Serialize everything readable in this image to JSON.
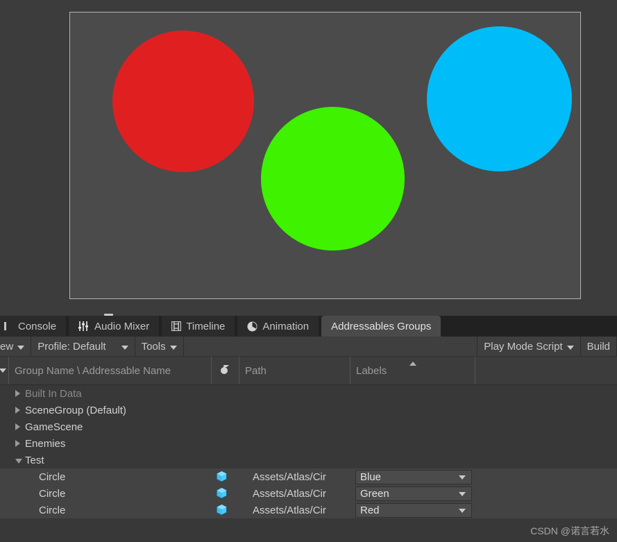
{
  "game_view": {
    "background": "#4b4b4b",
    "objects": [
      {
        "name": "circle-red",
        "color": "#e02020"
      },
      {
        "name": "circle-green",
        "color": "#3ef200"
      },
      {
        "name": "circle-blue",
        "color": "#00bdf9"
      }
    ]
  },
  "tabs": [
    {
      "id": "console",
      "label": "Console",
      "icon": "console-icon",
      "active": false
    },
    {
      "id": "audio-mixer",
      "label": "Audio Mixer",
      "icon": "sliders-icon",
      "active": false
    },
    {
      "id": "timeline",
      "label": "Timeline",
      "icon": "film-icon",
      "active": false
    },
    {
      "id": "animation",
      "label": "Animation",
      "icon": "clock-icon",
      "active": false
    },
    {
      "id": "addressables-groups",
      "label": "Addressables Groups",
      "icon": "",
      "active": true
    }
  ],
  "toolbar": {
    "new_label": "ew",
    "profile_label": "Profile: Default",
    "tools_label": "Tools",
    "play_mode_script_label": "Play Mode Script",
    "build_label": "Build"
  },
  "columns": [
    {
      "id": "name",
      "label": "Group Name \\ Addressable Name"
    },
    {
      "id": "icon",
      "label": ""
    },
    {
      "id": "path",
      "label": "Path"
    },
    {
      "id": "labels",
      "label": "Labels"
    },
    {
      "id": "extra",
      "label": ""
    }
  ],
  "sort": {
    "column": "labels",
    "direction": "ascending"
  },
  "tree": [
    {
      "type": "group",
      "label": "Built In Data",
      "expanded": false,
      "dim": true,
      "selected": false
    },
    {
      "type": "group",
      "label": "SceneGroup (Default)",
      "expanded": false,
      "dim": false,
      "selected": false
    },
    {
      "type": "group",
      "label": "GameScene",
      "expanded": false,
      "dim": false,
      "selected": false
    },
    {
      "type": "group",
      "label": "Enemies",
      "expanded": false,
      "dim": false,
      "selected": false
    },
    {
      "type": "group",
      "label": "Test",
      "expanded": true,
      "dim": false,
      "selected": false
    },
    {
      "type": "entry",
      "label": "Circle",
      "icon": "prefab-icon",
      "path": "Assets/Atlas/Cir",
      "label_value": "Blue",
      "selected": true
    },
    {
      "type": "entry",
      "label": "Circle",
      "icon": "prefab-icon",
      "path": "Assets/Atlas/Cir",
      "label_value": "Green",
      "selected": true
    },
    {
      "type": "entry",
      "label": "Circle",
      "icon": "prefab-icon",
      "path": "Assets/Atlas/Cir",
      "label_value": "Red",
      "selected": true
    }
  ],
  "watermark": "CSDN @诺言若水"
}
